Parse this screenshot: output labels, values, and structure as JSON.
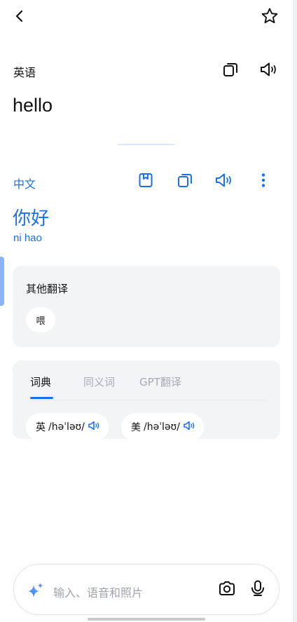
{
  "source": {
    "language": "英语",
    "text": "hello"
  },
  "target": {
    "language": "中文",
    "text": "你好",
    "pinyin": "ni hao"
  },
  "other_translations": {
    "title": "其他翻译",
    "items": [
      "喂"
    ]
  },
  "dictionary": {
    "tabs": [
      {
        "label": "词典",
        "active": true
      },
      {
        "label": "同义词",
        "active": false
      },
      {
        "label": "GPT翻译",
        "active": false
      }
    ],
    "pronunciations": [
      {
        "region": "英",
        "ipa": "/həˈləʊ/"
      },
      {
        "region": "美",
        "ipa": "/həˈləʊ/"
      }
    ]
  },
  "input": {
    "placeholder": "输入、语音和照片"
  },
  "colors": {
    "accent": "#1a6ff0",
    "card_bg": "#f3f4f6",
    "placeholder": "#a0a3aa"
  },
  "icons": {
    "back": "chevron-left-icon",
    "favorite": "star-outline-icon",
    "copy": "copy-icon",
    "speaker": "speaker-icon",
    "bookmark": "bookmark-icon",
    "more": "more-vertical-icon",
    "sparkle": "sparkle-icon",
    "camera": "camera-icon",
    "microphone": "microphone-icon"
  }
}
